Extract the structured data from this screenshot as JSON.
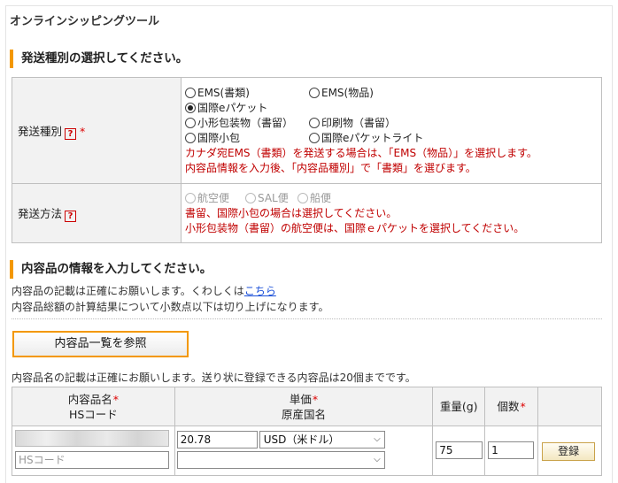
{
  "app_title": "オンラインシッピングツール",
  "section1": {
    "heading": "発送種別の選択してください。",
    "type_label": "発送種別",
    "help_mark": "?",
    "required_mark": "*",
    "options": [
      {
        "label": "EMS(書類)",
        "selected": false
      },
      {
        "label": "EMS(物品)",
        "selected": false
      },
      {
        "label": "国際eパケット",
        "selected": true
      },
      {
        "label": "小形包装物（書留）",
        "selected": false
      },
      {
        "label": "印刷物（書留）",
        "selected": false
      },
      {
        "label": "国際小包",
        "selected": false
      },
      {
        "label": "国際eパケットライト",
        "selected": false
      }
    ],
    "note1": "カナダ宛EMS（書類）を発送する場合は、「EMS（物品）」を選択します。",
    "note2": "内容品情報を入力後、「内容品種別」で「書類」を選びます。",
    "method_label": "発送方法",
    "methods": [
      "航空便",
      "SAL便",
      "船便"
    ],
    "method_note1": "書留、国際小包の場合は選択してください。",
    "method_note2": "小形包装物（書留）の航空便は、国際ｅパケットを選択してください。"
  },
  "section2": {
    "heading": "内容品の情報を入力してください。",
    "line1_prefix": "内容品の記載は正確にお願いします。くわしくは",
    "line1_link": "こちら",
    "line2": "内容品総額の計算結果について小数点以下は切り上げになります。",
    "ref_button": "内容品一覧を参照",
    "max_note": "内容品名の記載は正確にお願いします。送り状に登録できる内容品は20個までです。"
  },
  "items_table": {
    "col_name": "内容品名",
    "col_hs": "HSコード",
    "col_price": "単価",
    "col_origin": "原産国名",
    "col_weight": "重量(g)",
    "col_qty": "個数",
    "required_mark": "*",
    "row": {
      "hs_placeholder": "HSコード",
      "price": "20.78",
      "currency": "USD（米ドル）",
      "origin": "",
      "weight": "75",
      "qty": "1",
      "register_button": "登録"
    }
  }
}
